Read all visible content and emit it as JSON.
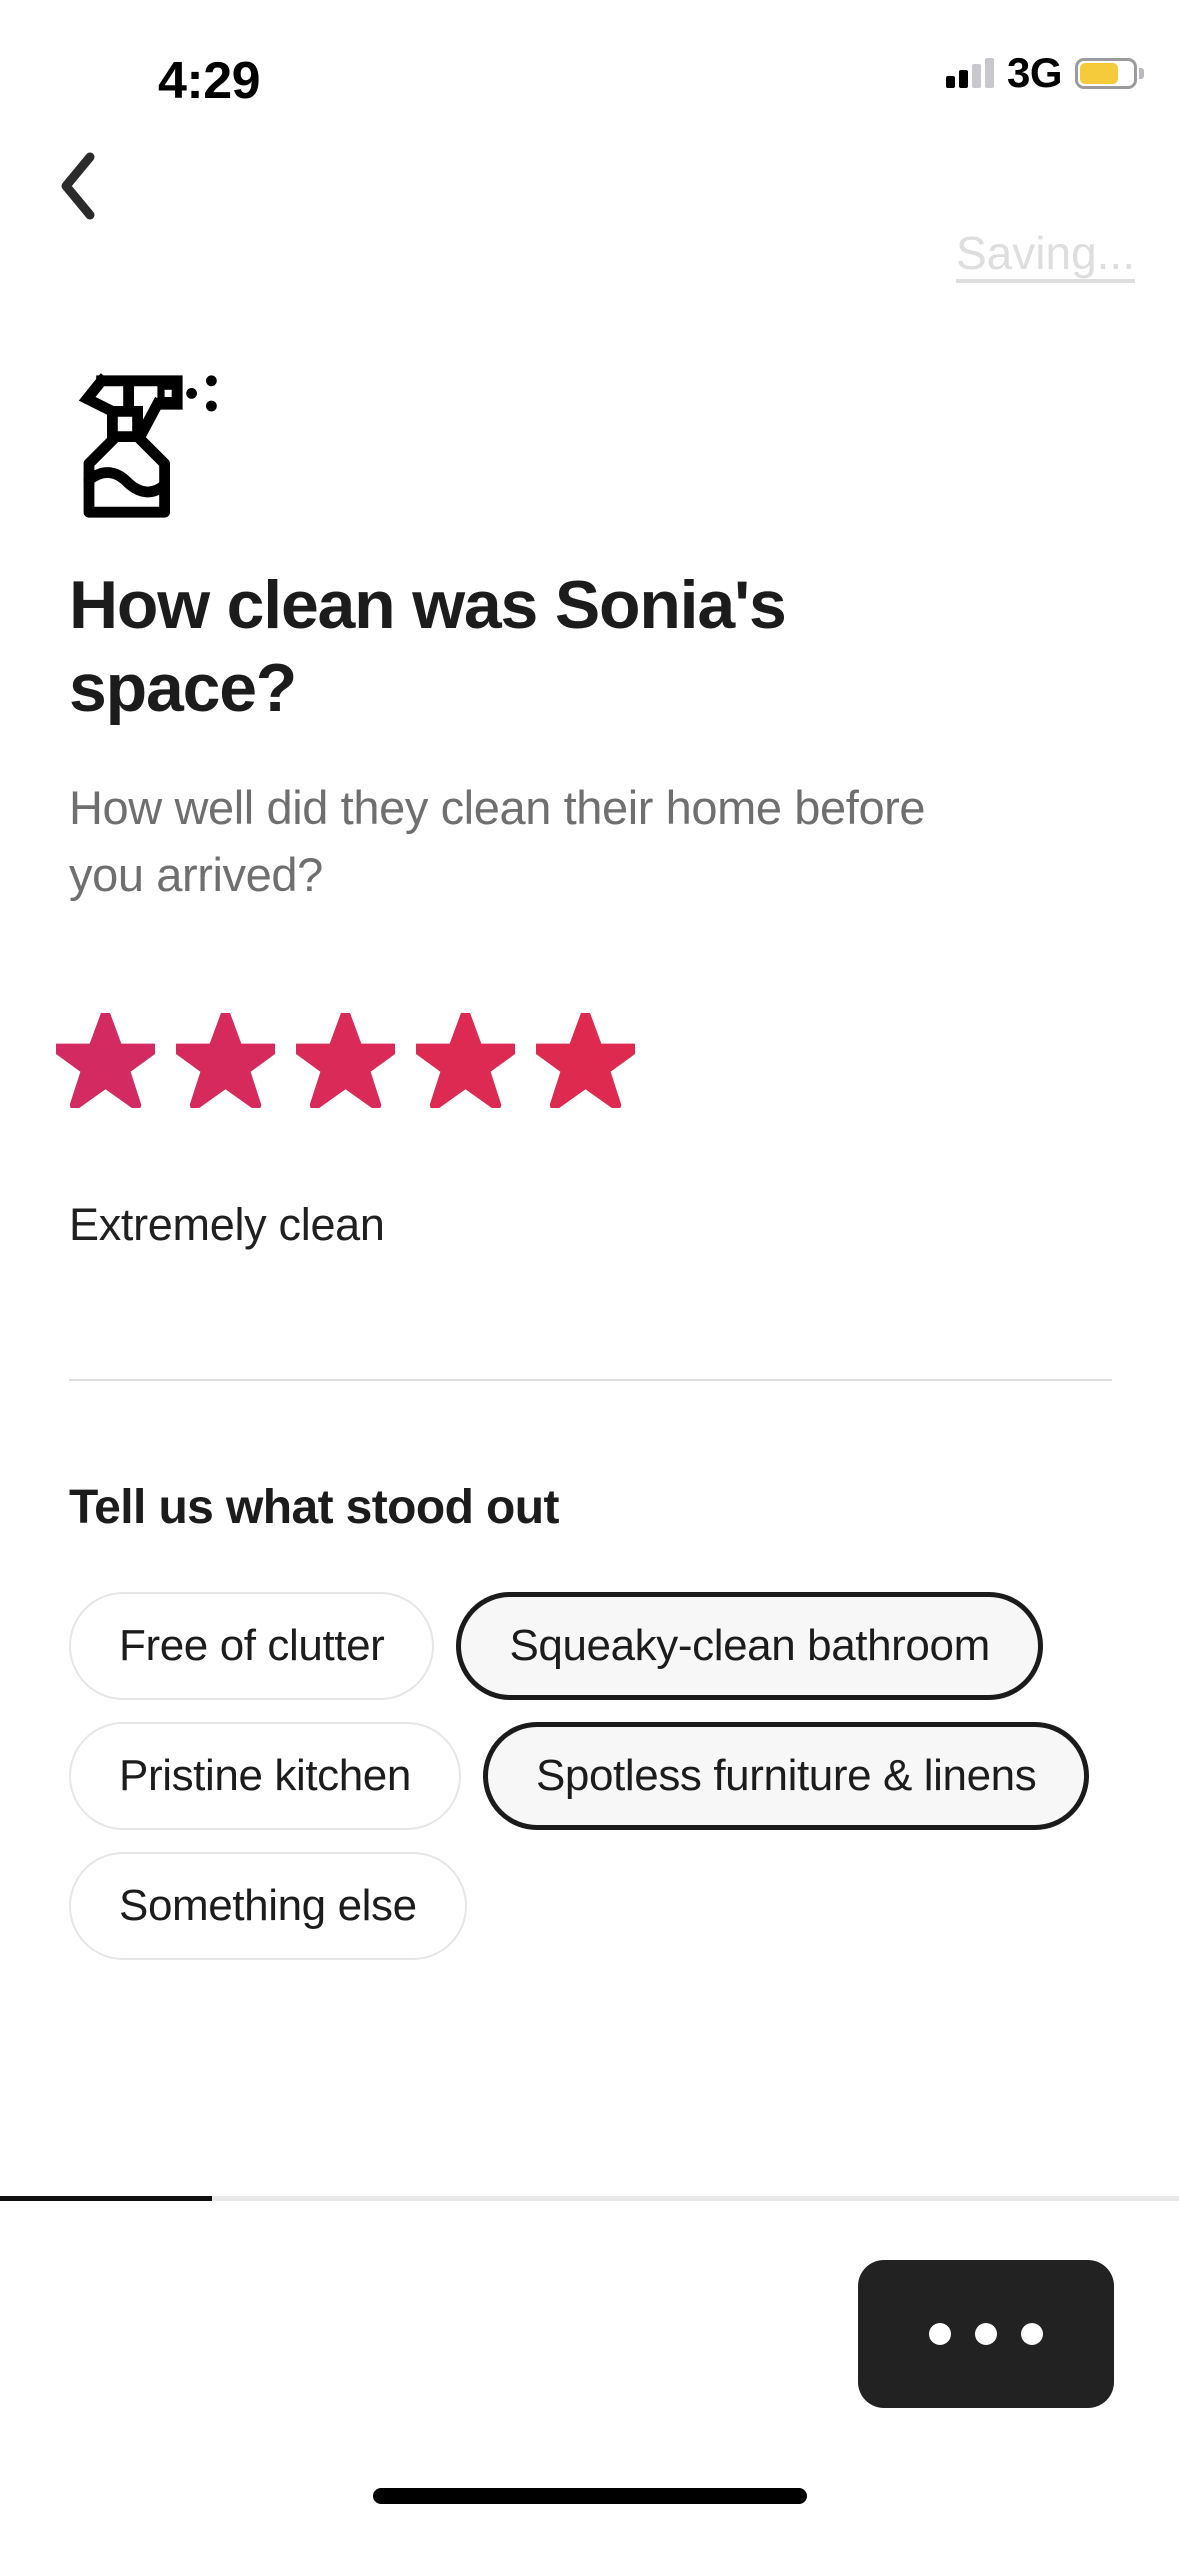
{
  "status_bar": {
    "time": "4:29",
    "network": "3G",
    "signal_icon": "signal-bars-icon",
    "signal_bars_filled": 2,
    "signal_bars_total": 4,
    "battery_icon": "battery-icon",
    "battery_color": "#f5cb3c",
    "battery_level_percent": 60
  },
  "nav": {
    "back_icon": "chevron-left-icon",
    "saving_label": "Saving..."
  },
  "main": {
    "hero_icon": "spray-bottle-icon",
    "headline": "How clean was Sonia's space?",
    "subhead": "How well did they clean their home before you arrived?",
    "rating": {
      "value": 5,
      "max": 5,
      "label": "Extremely clean",
      "star_icon": "star-icon",
      "star_colors": [
        "#d32a62",
        "#d62a5d",
        "#d92a58",
        "#dc2a53",
        "#de2a4e"
      ]
    },
    "section_title": "Tell us what stood out",
    "chips": [
      {
        "label": "Free of clutter",
        "selected": false
      },
      {
        "label": "Squeaky-clean bathroom",
        "selected": true
      },
      {
        "label": "Pristine kitchen",
        "selected": false
      },
      {
        "label": "Spotless furniture & linens",
        "selected": true
      },
      {
        "label": "Something else",
        "selected": false
      }
    ]
  },
  "bottom": {
    "progress_percent": 18,
    "progress_color": "#0f0f0f",
    "more_button_icon": "ellipsis-icon",
    "more_button_color": "#222222",
    "home_indicator": "home-indicator"
  }
}
